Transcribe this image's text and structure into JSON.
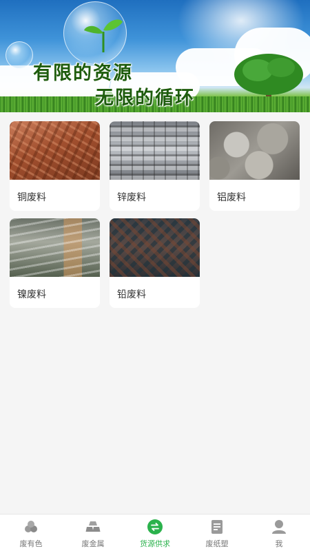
{
  "banner": {
    "slogan_line1": "有限的资源",
    "slogan_line2": "无限的循环"
  },
  "categories": [
    {
      "label": "铜废料",
      "image": "copper-scrap-image"
    },
    {
      "label": "锌废料",
      "image": "zinc-scrap-image"
    },
    {
      "label": "铝废料",
      "image": "aluminum-scrap-image"
    },
    {
      "label": "镍废料",
      "image": "nickel-scrap-image"
    },
    {
      "label": "铅废料",
      "image": "lead-scrap-image"
    }
  ],
  "bottom_nav": {
    "active_color": "#2bb24c",
    "items": [
      {
        "label": "废有色",
        "icon": "ore-icon"
      },
      {
        "label": "废金属",
        "icon": "ingot-icon"
      },
      {
        "label": "货源供求",
        "icon": "exchange-icon",
        "active": true
      },
      {
        "label": "废纸塑",
        "icon": "document-icon"
      },
      {
        "label": "我",
        "icon": "user-icon"
      }
    ]
  }
}
